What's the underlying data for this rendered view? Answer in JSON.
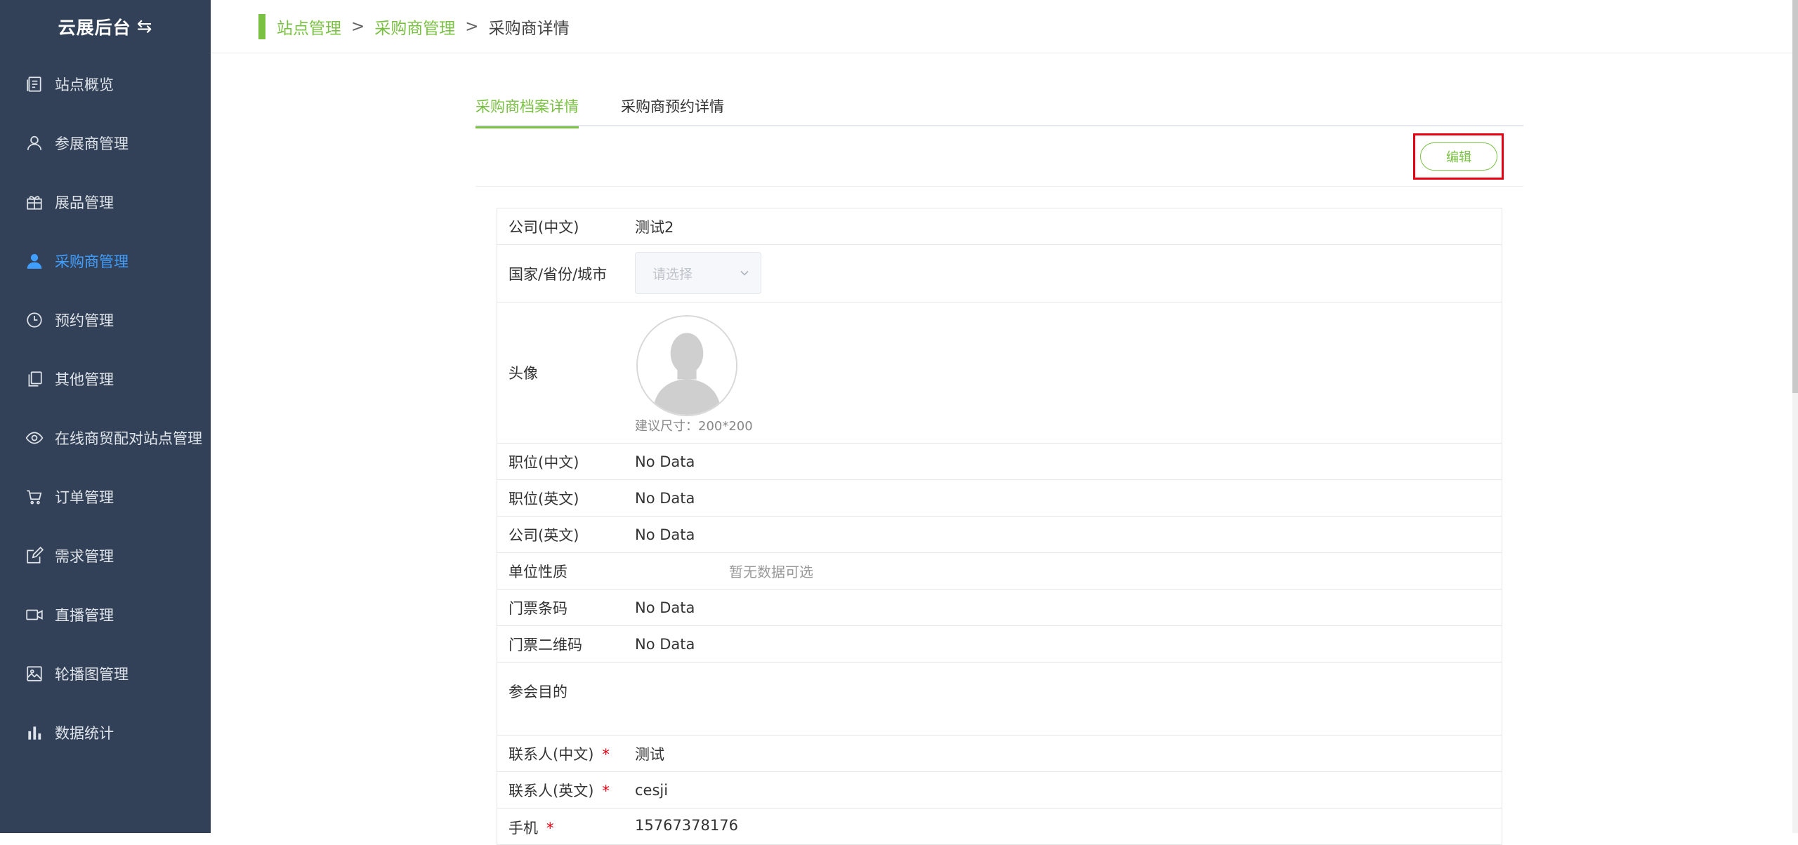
{
  "app": {
    "title": "云展后台",
    "swap_icon": "swap-icon"
  },
  "sidebar": {
    "items": [
      {
        "label": "站点概览",
        "icon": "site-overview-icon"
      },
      {
        "label": "参展商管理",
        "icon": "user-outline-icon"
      },
      {
        "label": "展品管理",
        "icon": "gift-icon"
      },
      {
        "label": "采购商管理",
        "icon": "user-filled-icon",
        "active": true
      },
      {
        "label": "预约管理",
        "icon": "clock-icon"
      },
      {
        "label": "其他管理",
        "icon": "copy-icon"
      },
      {
        "label": "在线商贸配对站点管理",
        "icon": "eye-icon"
      },
      {
        "label": "订单管理",
        "icon": "cart-icon"
      },
      {
        "label": "需求管理",
        "icon": "edit-icon"
      },
      {
        "label": "直播管理",
        "icon": "video-camera-icon"
      },
      {
        "label": "轮播图管理",
        "icon": "picture-icon"
      },
      {
        "label": "数据统计",
        "icon": "bar-chart-icon"
      }
    ]
  },
  "breadcrumb": {
    "level1": "站点管理",
    "sep": ">",
    "level2": "采购商管理",
    "current": "采购商详情"
  },
  "tabs": {
    "profile": "采购商档案详情",
    "booking": "采购商预约详情"
  },
  "toolbar": {
    "edit_label": "编辑"
  },
  "form": {
    "company_cn": {
      "label": "公司(中文)",
      "value": "测试2"
    },
    "region": {
      "label": "国家/省份/城市",
      "placeholder": "请选择"
    },
    "avatar": {
      "label": "头像",
      "hint": "建议尺寸：200*200"
    },
    "position_cn": {
      "label": "职位(中文)",
      "value": "No Data"
    },
    "position_en": {
      "label": "职位(英文)",
      "value": "No Data"
    },
    "company_en": {
      "label": "公司(英文)",
      "value": "No Data"
    },
    "unit_type": {
      "label": "单位性质",
      "value": "暂无数据可选"
    },
    "ticket_barcode": {
      "label": "门票条码",
      "value": "No Data"
    },
    "ticket_qrcode": {
      "label": "门票二维码",
      "value": "No Data"
    },
    "purpose": {
      "label": "参会目的",
      "value": ""
    },
    "contact_cn": {
      "label": "联系人(中文)",
      "required": "*",
      "value": "测试"
    },
    "contact_en": {
      "label": "联系人(英文)",
      "required": "*",
      "value": "cesji"
    },
    "mobile": {
      "label": "手机",
      "required": "*",
      "value": "15767378176"
    }
  },
  "colors": {
    "sidebar_bg": "#324157",
    "accent": "#7ac143",
    "active_nav": "#409eff",
    "highlight_border": "#e60012"
  }
}
